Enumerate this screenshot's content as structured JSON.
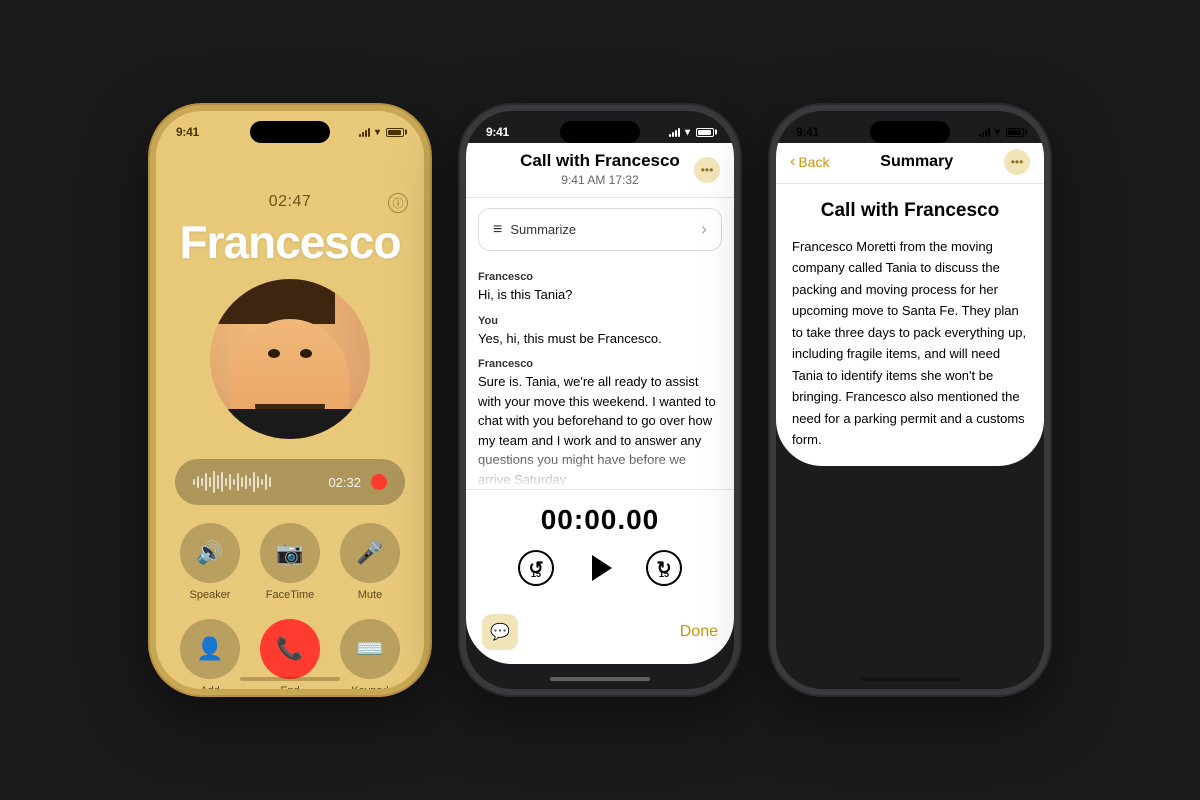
{
  "background": "#1a1a1a",
  "phone1": {
    "status_time": "9:41",
    "call_duration_display": "02:47",
    "caller_name": "Francesco",
    "waveform_time": "02:32",
    "buttons": {
      "speaker": "Speaker",
      "facetime": "FaceTime",
      "mute": "Mute",
      "add": "Add",
      "end": "End",
      "keypad": "Keypad"
    }
  },
  "phone2": {
    "status_time": "9:41",
    "header_title": "Call with Francesco",
    "header_subtitle": "9:41 AM  17:32",
    "summarize_label": "Summarize",
    "transcript": [
      {
        "speaker": "Francesco",
        "text": "Hi, is this Tania?"
      },
      {
        "speaker": "You",
        "text": "Yes, hi, this must be Francesco."
      },
      {
        "speaker": "Francesco",
        "text": "Sure is. Tania, we're all ready to assist with your move this weekend. I wanted to chat with you beforehand to go over how my team and I work and to answer any questions you might have before we arrive Saturday"
      }
    ],
    "playback_timer": "00:00.00",
    "done_label": "Done"
  },
  "phone3": {
    "status_time": "9:41",
    "back_label": "Back",
    "nav_title": "Summary",
    "summary_title": "Call with Francesco",
    "summary_text": "Francesco Moretti from the moving company called Tania to discuss the packing and moving process for her upcoming move to Santa Fe. They plan to take three days to pack everything up, including fragile items, and will need Tania to identify items she won't be bringing. Francesco also mentioned the need for a parking permit and a customs form."
  }
}
